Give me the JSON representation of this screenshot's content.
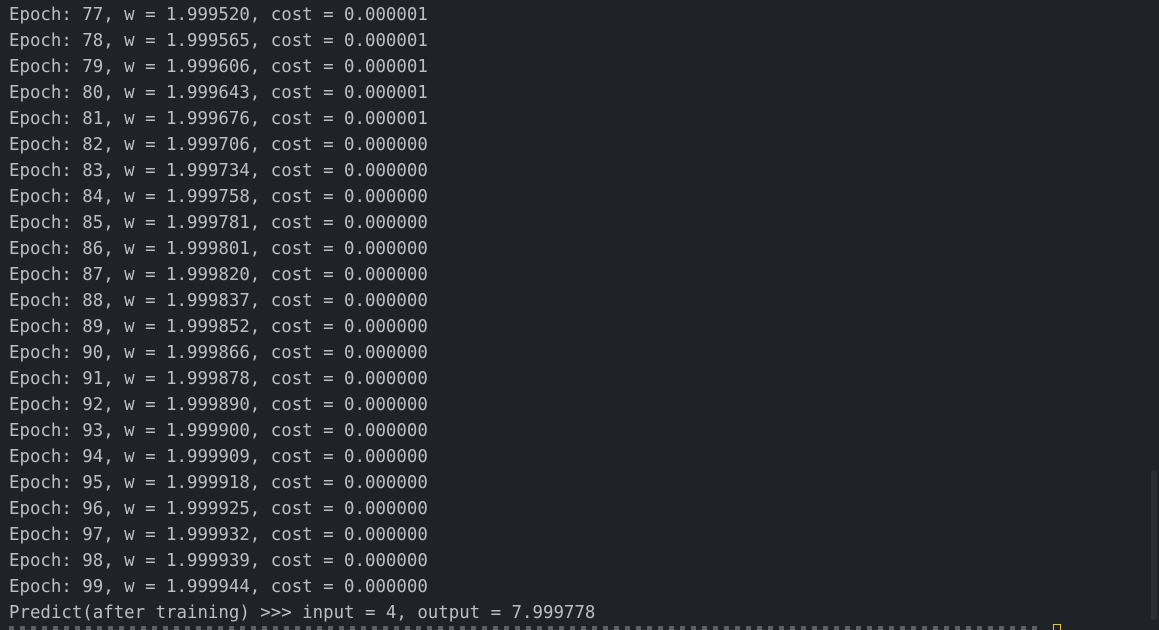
{
  "console": {
    "lines": [
      "Epoch: 77, w = 1.999520, cost = 0.000001",
      "Epoch: 78, w = 1.999565, cost = 0.000001",
      "Epoch: 79, w = 1.999606, cost = 0.000001",
      "Epoch: 80, w = 1.999643, cost = 0.000001",
      "Epoch: 81, w = 1.999676, cost = 0.000001",
      "Epoch: 82, w = 1.999706, cost = 0.000000",
      "Epoch: 83, w = 1.999734, cost = 0.000000",
      "Epoch: 84, w = 1.999758, cost = 0.000000",
      "Epoch: 85, w = 1.999781, cost = 0.000000",
      "Epoch: 86, w = 1.999801, cost = 0.000000",
      "Epoch: 87, w = 1.999820, cost = 0.000000",
      "Epoch: 88, w = 1.999837, cost = 0.000000",
      "Epoch: 89, w = 1.999852, cost = 0.000000",
      "Epoch: 90, w = 1.999866, cost = 0.000000",
      "Epoch: 91, w = 1.999878, cost = 0.000000",
      "Epoch: 92, w = 1.999890, cost = 0.000000",
      "Epoch: 93, w = 1.999900, cost = 0.000000",
      "Epoch: 94, w = 1.999909, cost = 0.000000",
      "Epoch: 95, w = 1.999918, cost = 0.000000",
      "Epoch: 96, w = 1.999925, cost = 0.000000",
      "Epoch: 97, w = 1.999932, cost = 0.000000",
      "Epoch: 98, w = 1.999939, cost = 0.000000",
      "Epoch: 99, w = 1.999944, cost = 0.000000",
      "Predict(after training) >>> input = 4, output = 7.999778"
    ]
  },
  "colors": {
    "background": "#1f2329",
    "text": "#bcbec4",
    "caret": "#e6c34a"
  },
  "icons": {
    "caret": "text-cursor-icon"
  }
}
